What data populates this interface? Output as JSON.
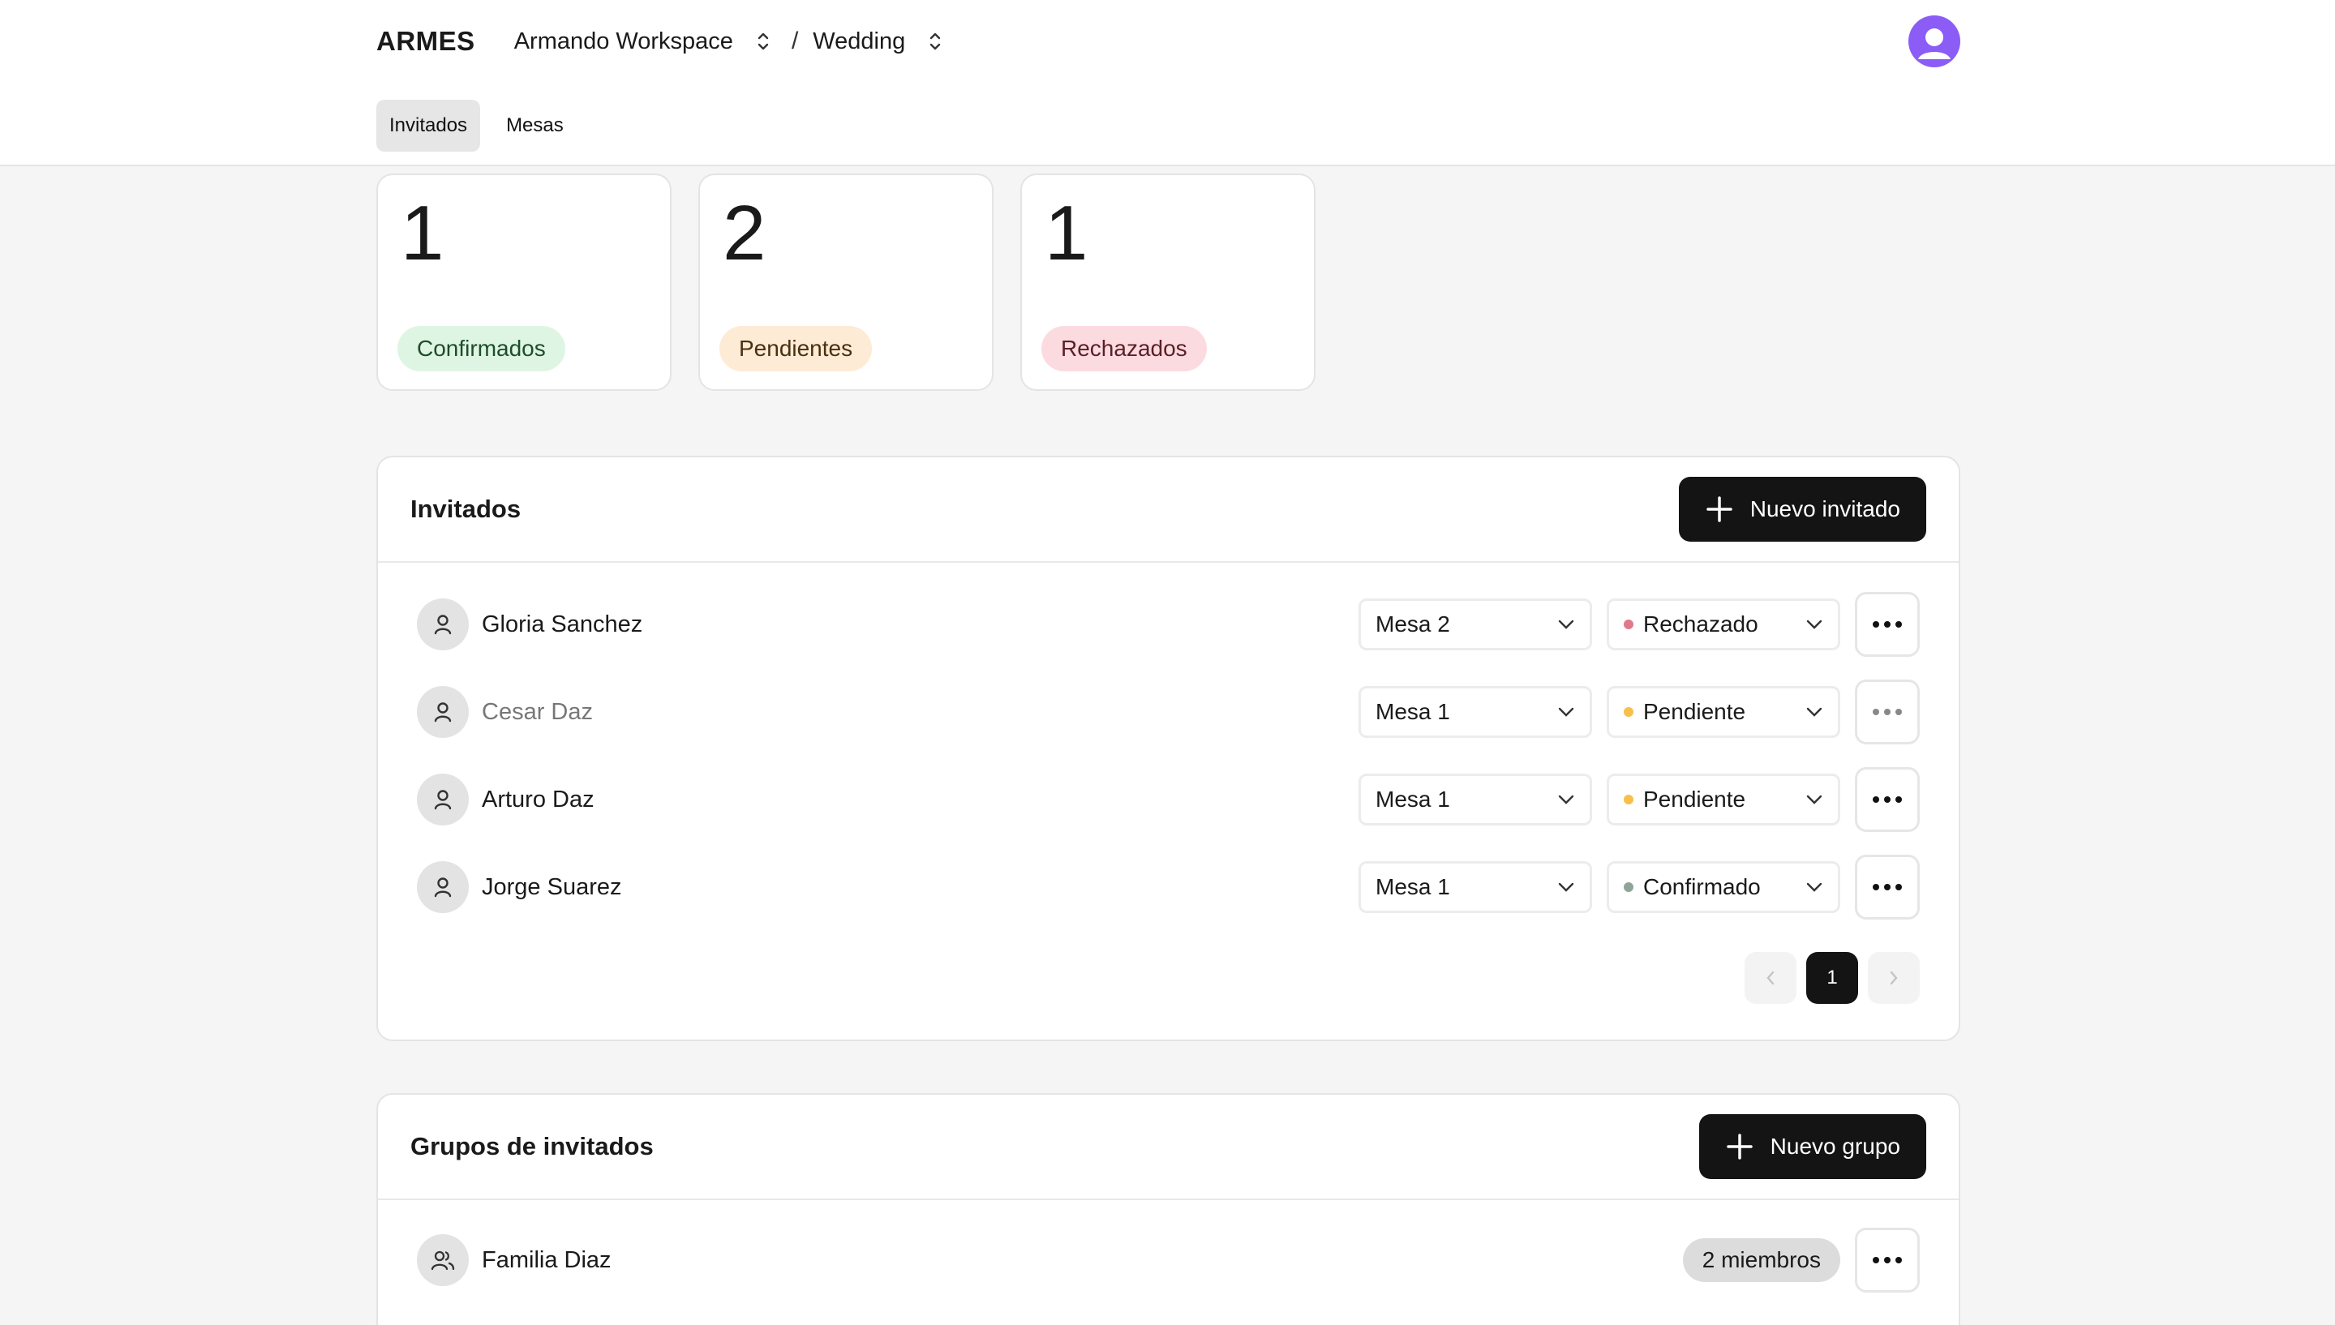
{
  "header": {
    "brand": "ARMES",
    "workspace": "Armando Workspace",
    "separator": "/",
    "project": "Wedding"
  },
  "tabs": [
    {
      "label": "Invitados",
      "active": true
    },
    {
      "label": "Mesas",
      "active": false
    }
  ],
  "stats": [
    {
      "value": "1",
      "label": "Confirmados",
      "bg": "#dff5e3",
      "fg": "#1f4d2b"
    },
    {
      "value": "2",
      "label": "Pendientes",
      "bg": "#fdebd6",
      "fg": "#4a3010"
    },
    {
      "value": "1",
      "label": "Rechazados",
      "bg": "#fcdbe0",
      "fg": "#5a1f28"
    }
  ],
  "guests_panel": {
    "title": "Invitados",
    "add_label": "Nuevo invitado",
    "rows": [
      {
        "name": "Gloria Sanchez",
        "table": "Mesa 2",
        "status": "Rechazado",
        "dot": "#e07a8a",
        "muted": false
      },
      {
        "name": "Cesar Daz",
        "table": "Mesa 1",
        "status": "Pendiente",
        "dot": "#f7c04a",
        "muted": true
      },
      {
        "name": "Arturo Daz",
        "table": "Mesa 1",
        "status": "Pendiente",
        "dot": "#f7c04a",
        "muted": false
      },
      {
        "name": "Jorge Suarez",
        "table": "Mesa 1",
        "status": "Confirmado",
        "dot": "#8fa59a",
        "muted": false
      }
    ],
    "pagination": {
      "current": "1"
    }
  },
  "groups_panel": {
    "title": "Grupos de invitados",
    "add_label": "Nuevo grupo",
    "rows": [
      {
        "name": "Familia Diaz",
        "members": "2 miembros"
      }
    ]
  },
  "colors": {
    "primary": "#141414",
    "avatar": "#8b5cf6"
  }
}
